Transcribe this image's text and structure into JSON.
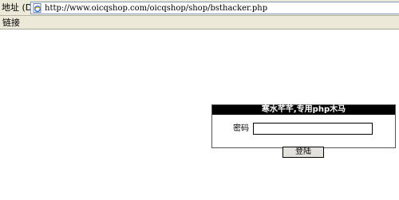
{
  "browser": {
    "address_label": "地址 (D)",
    "url": "http://www.oicqshop.com/oicqshop/shop/bsthacker.php",
    "page_icon": "ie-page-icon",
    "links_label": "链接"
  },
  "login": {
    "title": "寒水芊芊,专用php木马",
    "password_label": "密码",
    "password_value": "",
    "submit_label": "登陆"
  }
}
